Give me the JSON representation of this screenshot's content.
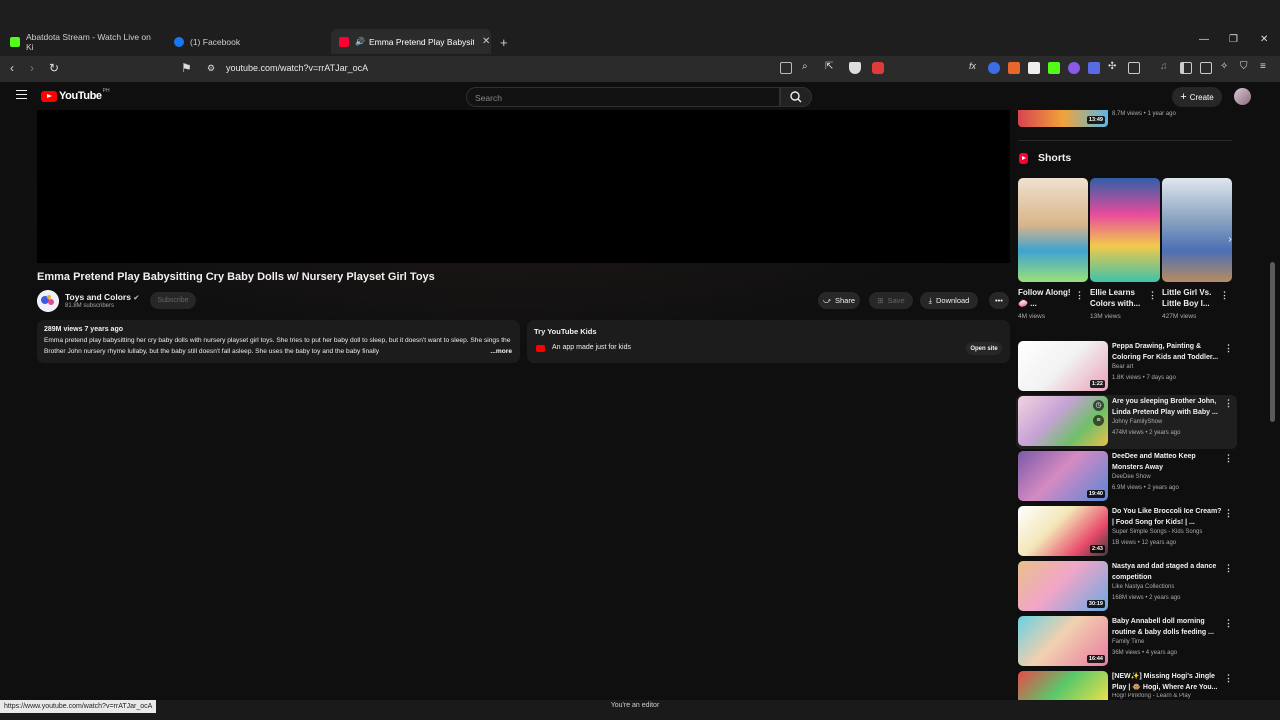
{
  "browser": {
    "tabs": [
      {
        "title": "Abatdota Stream - Watch Live on Ki",
        "color": "#53fc18"
      },
      {
        "title": "(1) Facebook",
        "color": "#1877f2"
      },
      {
        "title": "Emma Pretend Play Babysitti",
        "color": "#ff0033"
      }
    ],
    "url": "youtube.com/watch?v=rrATJar_ocA",
    "status_url": "https://www.youtube.com/watch?v=rrATJar_ocA",
    "status_text": "You're an editor"
  },
  "youtube": {
    "logo_text": "YouTube",
    "logo_region": "PH",
    "search_placeholder": "Search",
    "create_label": "Create"
  },
  "video": {
    "title": "Emma Pretend Play Babysitting Cry Baby Dolls w/ Nursery Playset Girl Toys",
    "channel": "Toys and Colors",
    "subscribers": "81.8M subscribers",
    "subscribe_label": "Subscribe",
    "actions": {
      "share": "Share",
      "save": "Save",
      "download": "Download"
    },
    "description_meta": "289M views  7 years ago",
    "description": "Emma pretend play babysitting her cry baby dolls with nursery playset girl toys. She tries to put her baby doll to sleep, but it doesn't want to sleep. She sings the Brother John nursery rhyme lullaby, but the baby still doesn't fall asleep. She uses the baby toy and the baby finally",
    "more_label": "...more"
  },
  "promo": {
    "title": "Try YouTube Kids",
    "subtitle": "An app made just for kids",
    "button": "Open site"
  },
  "sidebar": {
    "top_item": {
      "duration": "13:49",
      "meta": "8.7M views • 1 year ago"
    },
    "shorts_heading": "Shorts",
    "shorts": [
      {
        "title": "Follow Along! 🧼 ...",
        "views": "4M views"
      },
      {
        "title": "Ellie Learns Colors with...",
        "views": "13M views"
      },
      {
        "title": "Little Girl Vs. Little Boy I...",
        "views": "427M views"
      }
    ],
    "recommendations": [
      {
        "title": "Peppa Drawing, Painting & Coloring For Kids and Toddler...",
        "channel": "Bear art",
        "meta": "1.8K views • 7 days ago",
        "duration": "1:22"
      },
      {
        "title": "Are you sleeping Brother John, Linda Pretend Play with Baby ...",
        "channel": "Johny FamilyShow",
        "meta": "474M views • 2 years ago",
        "duration": ""
      },
      {
        "title": "DeeDee and Matteo Keep Monsters Away",
        "channel": "DeeDee Show",
        "meta": "6.9M views • 2 years ago",
        "duration": "19:40"
      },
      {
        "title": "Do You Like Broccoli Ice Cream? | Food Song for Kids! | ...",
        "channel": "Super Simple Songs - Kids Songs",
        "meta": "1B views • 12 years ago",
        "duration": "2:43"
      },
      {
        "title": "Nastya and dad staged a dance competition",
        "channel": "Like Nastya Collections",
        "meta": "168M views • 2 years ago",
        "duration": "30:19"
      },
      {
        "title": "Baby Annabell doll morning routine & baby dolls feeding ...",
        "channel": "Family Time",
        "meta": "36M views • 4 years ago",
        "duration": "16:44"
      },
      {
        "title": "[NEW✨] Missing Hogi's Jingle Play | 🐵 Hogi, Where Are You...",
        "channel": "Hogi! Pinkfong - Learn & Play",
        "meta": "",
        "duration": ""
      }
    ]
  }
}
